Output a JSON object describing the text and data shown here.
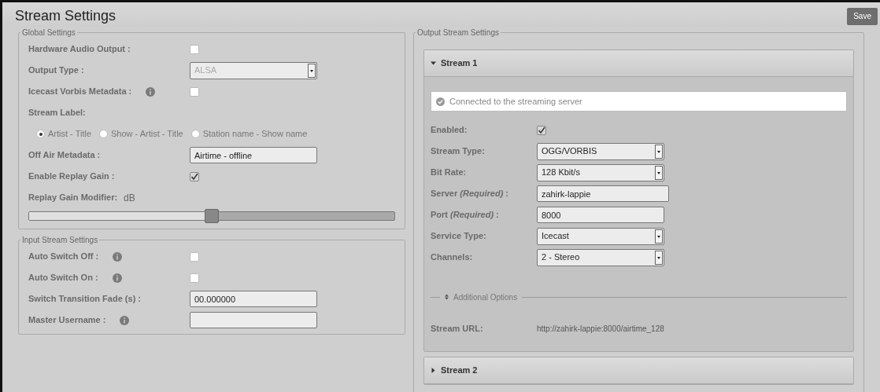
{
  "page": {
    "title": "Stream Settings",
    "save_button": "Save"
  },
  "global_settings": {
    "legend": "Global Settings",
    "rows": [
      {
        "kind": "checkbox",
        "label": "Hardware Audio Output :",
        "checked": false
      },
      {
        "kind": "select",
        "label": "Output Type :",
        "value": "ALSA",
        "disabled": true
      },
      {
        "kind": "checkbox",
        "label": "Icecast Vorbis Metadata :",
        "info": true,
        "checked": false
      },
      {
        "kind": "radio_group",
        "label": "Stream Label:",
        "options": [
          {
            "label": "Artist - Title",
            "selected": true
          },
          {
            "label": "Show - Artist - Title",
            "selected": false
          },
          {
            "label": "Station name - Show name",
            "selected": false
          }
        ]
      },
      {
        "kind": "text",
        "label": "Off Air Metadata :",
        "value": "Airtime - offline"
      },
      {
        "kind": "checkbox",
        "label": "Enable Replay Gain :",
        "checked": true
      },
      {
        "kind": "slider",
        "label": "Replay Gain Modifier:",
        "unit": "dB",
        "level": 0.5
      }
    ]
  },
  "input_stream_settings": {
    "legend": "Input Stream Settings",
    "rows": [
      {
        "kind": "checkbox",
        "label": "Auto Switch Off :",
        "info": true,
        "checked": false
      },
      {
        "kind": "checkbox",
        "label": "Auto Switch On :",
        "info": true,
        "checked": false
      },
      {
        "kind": "text",
        "label": "Switch Transition Fade (s) :",
        "value": "00.000000"
      },
      {
        "kind": "text",
        "label": "Master Username :",
        "info": true
      }
    ]
  },
  "output_stream_settings": {
    "legend": "Output Stream Settings",
    "streams": [
      {
        "title": "Stream 1",
        "expanded": true,
        "status": "Connected to the streaming server",
        "rows": [
          {
            "kind": "checkbox",
            "label": "Enabled:",
            "checked": true
          },
          {
            "kind": "select",
            "label": "Stream Type:",
            "value": "OGG/VORBIS",
            "disabled": false
          },
          {
            "kind": "select",
            "label": "Bit Rate:",
            "value": "128 Kbit/s",
            "disabled": false
          },
          {
            "kind": "text",
            "label": "Server *(Required)* :",
            "value": "zahirk-lappie",
            "wide": true
          },
          {
            "kind": "text",
            "label": "Port *(Required)* :",
            "value": "8000"
          },
          {
            "kind": "select",
            "label": "Service Type:",
            "value": "Icecast",
            "disabled": false
          },
          {
            "kind": "select",
            "label": "Channels:",
            "value": "2 - Stereo",
            "disabled": false
          }
        ],
        "additional_options": "Additional Options",
        "url_label": "Stream URL:",
        "url": "http://zahirk-lappie:8000/airtime_128"
      },
      {
        "title": "Stream 2",
        "expanded": false
      }
    ]
  }
}
